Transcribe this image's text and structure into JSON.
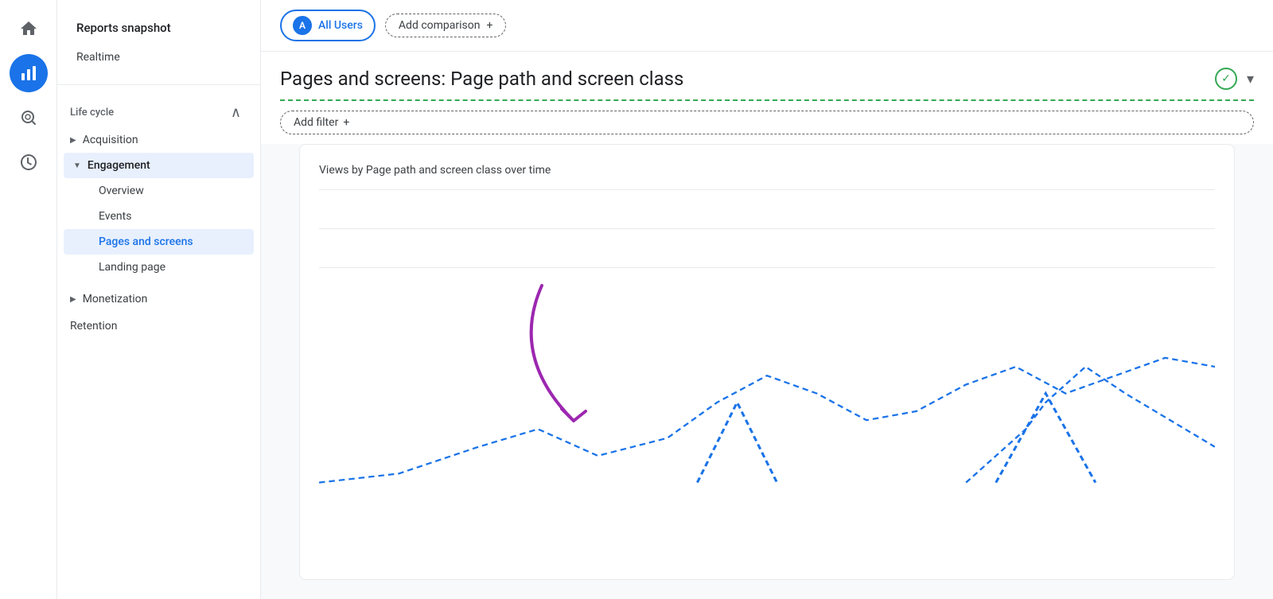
{
  "icon_sidebar": {
    "items": [
      {
        "name": "home",
        "symbol": "⌂",
        "active": false
      },
      {
        "name": "bar-chart",
        "symbol": "▦",
        "active": true
      },
      {
        "name": "search",
        "symbol": "⊙",
        "active": false
      },
      {
        "name": "explore",
        "symbol": "◎",
        "active": false
      }
    ]
  },
  "nav": {
    "reports_snapshot": "Reports snapshot",
    "realtime": "Realtime",
    "lifecycle_label": "Life cycle",
    "acquisition_label": "Acquisition",
    "engagement_label": "Engagement",
    "overview_label": "Overview",
    "events_label": "Events",
    "pages_and_screens_label": "Pages and screens",
    "landing_page_label": "Landing page",
    "monetization_label": "Monetization",
    "retention_label": "Retention"
  },
  "topbar": {
    "all_users_label": "All Users",
    "all_users_avatar": "A",
    "add_comparison_label": "Add comparison",
    "add_comparison_icon": "+"
  },
  "page": {
    "title": "Pages and screens: Page path and screen class",
    "add_filter_label": "Add filter",
    "add_filter_icon": "+",
    "chart_title": "Views by Page path and screen class over time"
  }
}
